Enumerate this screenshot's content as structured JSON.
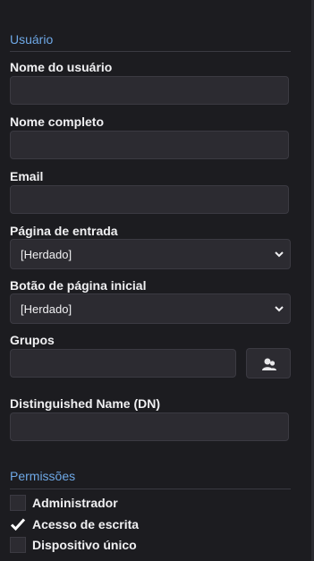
{
  "user_section": {
    "title": "Usuário",
    "username_label": "Nome do usuário",
    "username_value": "",
    "fullname_label": "Nome completo",
    "fullname_value": "",
    "email_label": "Email",
    "email_value": "",
    "home_page_label": "Página de entrada",
    "home_page_value": "[Herdado]",
    "home_button_label": "Botão de página inicial",
    "home_button_value": "[Herdado]",
    "groups_label": "Grupos",
    "groups_value": "",
    "dn_label": "Distinguished Name (DN)",
    "dn_value": ""
  },
  "permissions_section": {
    "title": "Permissões",
    "items": [
      {
        "label": "Administrador",
        "checked": false
      },
      {
        "label": "Acesso de escrita",
        "checked": true
      },
      {
        "label": "Dispositivo único",
        "checked": false
      }
    ]
  },
  "colors": {
    "section_title": "#6ea8e6",
    "input_bg": "#2c2b31",
    "panel_bg": "#1c1c20"
  },
  "icons": {
    "groups_button": "user-group-icon",
    "select_arrow": "chevron-down-icon",
    "checkmark": "checkmark-icon"
  }
}
